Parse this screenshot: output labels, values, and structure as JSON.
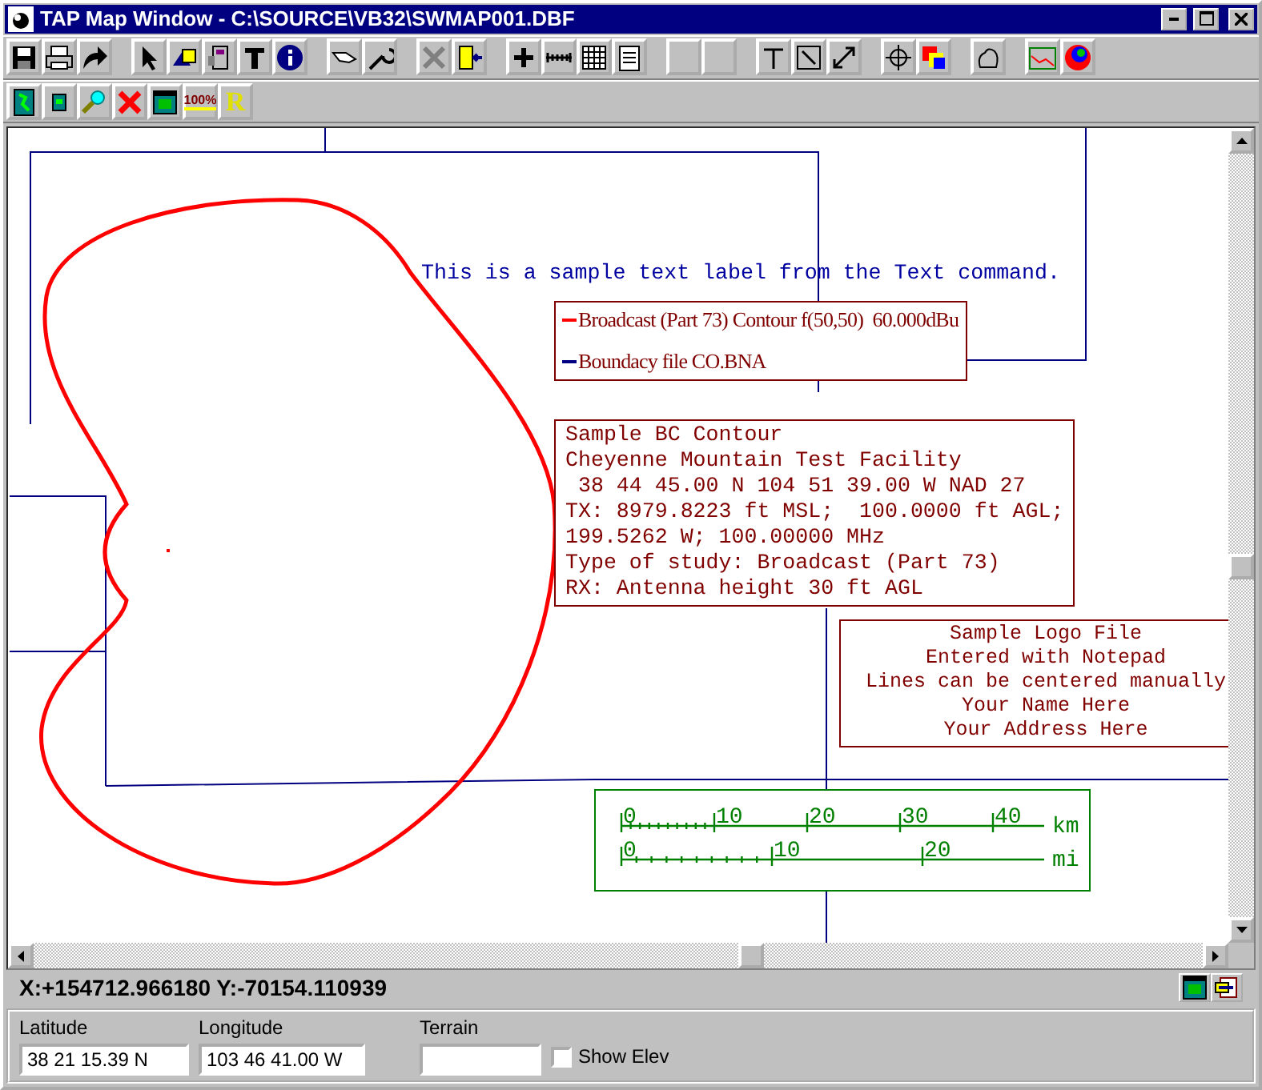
{
  "window": {
    "title": "TAP Map Window - C:\\SOURCE\\VB32\\SWMAP001.DBF"
  },
  "toolbar_glyphs": [
    "100%",
    "R"
  ],
  "map": {
    "text_label": "This is a sample text label from the Text command.",
    "legend": [
      {
        "label": "Broadcast (Part 73) Contour f(50,50)  60.000dBu",
        "color": "#ff0000"
      },
      {
        "label": "Boundacy file CO.BNA",
        "color": "#000080"
      }
    ],
    "info_lines": [
      "Sample BC Contour",
      "Cheyenne Mountain Test Facility",
      " 38 44 45.00 N 104 51 39.00 W NAD 27",
      "TX: 8979.8223 ft MSL;  100.0000 ft AGL;",
      "199.5262 W; 100.00000 MHz",
      "Type of study: Broadcast (Part 73)",
      "RX: Antenna height 30 ft AGL"
    ],
    "logo_lines": [
      "Sample Logo File",
      "Entered with Notepad",
      "Lines can be centered manually",
      "Your Name Here",
      "Your Address Here"
    ],
    "scale": [
      {
        "unit": "km",
        "ticks": [
          "0",
          "10",
          "20",
          "30",
          "40"
        ]
      },
      {
        "unit": "mi",
        "ticks": [
          "0",
          "10",
          "20"
        ]
      }
    ]
  },
  "status": {
    "coordinates": "X:+154712.966180 Y:-70154.110939"
  },
  "fields": {
    "latitude": {
      "label": "Latitude",
      "value": "38 21 15.39 N"
    },
    "longitude": {
      "label": "Longitude",
      "value": "103 46 41.00 W"
    },
    "terrain": {
      "label": "Terrain"
    },
    "show_elev": {
      "label": "Show Elev",
      "checked": false
    }
  }
}
